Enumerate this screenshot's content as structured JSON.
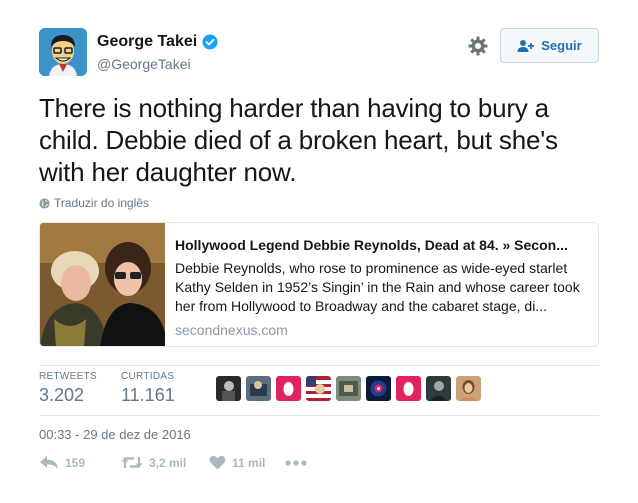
{
  "user": {
    "name": "George Takei",
    "handle": "@GeorgeTakei"
  },
  "header": {
    "follow_label": "Seguir"
  },
  "tweet": {
    "text": "There is nothing harder than having to bury a child. Debbie died of a broken heart, but she's with her daughter now.",
    "translate_label": "Traduzir do inglês"
  },
  "card": {
    "title": "Hollywood Legend Debbie Reynolds, Dead at 84. » Secon...",
    "description": "Debbie Reynolds, who rose to prominence as wide-eyed starlet Kathy Selden in 1952’s Singin’ in the Rain and whose career took her from Hollywood to Broadway and the cabaret stage, di...",
    "domain": "secondnexus.com"
  },
  "stats": {
    "retweets_label": "RETWEETS",
    "retweets_value": "3.202",
    "likes_label": "CURTIDAS",
    "likes_value": "11.161"
  },
  "timestamp": "00:33 - 29 de dez de 2016",
  "actions": {
    "reply_count": "159",
    "retweet_count": "3,2 mil",
    "like_count": "11 mil"
  },
  "colors": {
    "verified": "#1da1f2",
    "follow_text": "#1f6fb2",
    "meta_gray": "#657786",
    "action_gray": "#aab8c2"
  },
  "icons": [
    "verified-badge-icon",
    "gear-icon",
    "follow-person-icon",
    "globe-icon",
    "reply-icon",
    "retweet-icon",
    "heart-icon",
    "more-icon"
  ]
}
